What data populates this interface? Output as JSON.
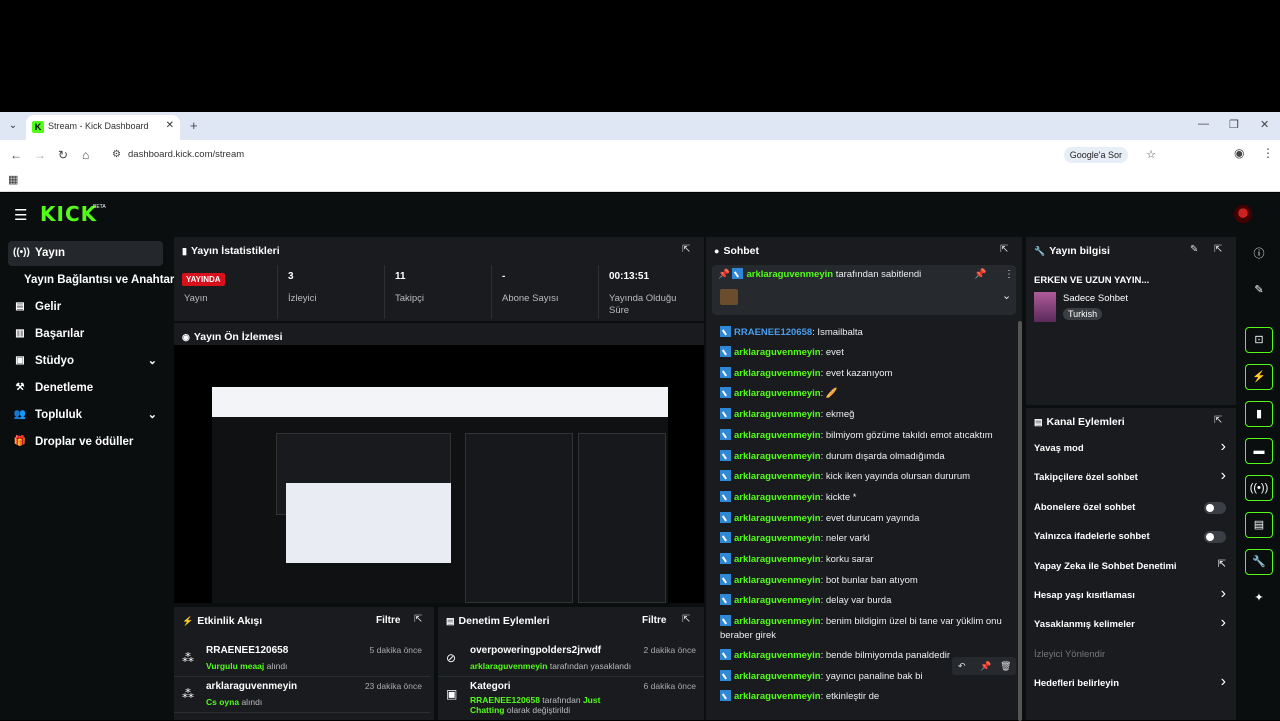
{
  "browser": {
    "tab_title": "Stream - Kick Dashboard",
    "url": "dashboard.kick.com/stream",
    "google_lens": "Google'a Sor"
  },
  "app": {
    "logo": "KICK",
    "logo_badge": "BETA"
  },
  "sidebar": {
    "items": [
      {
        "label": "Yayın",
        "icon": "broadcast-icon"
      },
      {
        "label": "Yayın Bağlantısı ve Anahtarı"
      },
      {
        "label": "Gelir",
        "icon": "revenue-icon"
      },
      {
        "label": "Başarılar",
        "icon": "achievements-icon"
      },
      {
        "label": "Stüdyo",
        "icon": "studio-icon"
      },
      {
        "label": "Denetleme",
        "icon": "moderation-icon"
      },
      {
        "label": "Topluluk",
        "icon": "community-icon"
      },
      {
        "label": "Droplar ve ödüller",
        "icon": "drops-icon"
      }
    ]
  },
  "stats": {
    "title": "Yayın İstatistikleri",
    "live_badge": "YAYINDA",
    "items": [
      {
        "value": "",
        "label": "Yayın"
      },
      {
        "value": "3",
        "label": "İzleyici"
      },
      {
        "value": "11",
        "label": "Takipçi"
      },
      {
        "value": "-",
        "label": "Abone Sayısı"
      },
      {
        "value": "00:13:51",
        "label": "Yayında Olduğu Süre"
      }
    ]
  },
  "preview": {
    "title": "Yayın Ön İzlemesi"
  },
  "activity": {
    "title": "Etkinlik Akışı",
    "filter": "Filtre",
    "items": [
      {
        "name": "RRAENEE120658",
        "highlight": "Vurgulu meaaj",
        "rest": " alındı",
        "time": "5 dakika önce"
      },
      {
        "name": "arklaraguvenmeyin",
        "highlight": "Cs oyna",
        "rest": " alındı",
        "time": "23 dakika önce"
      }
    ]
  },
  "mod_actions": {
    "title": "Denetim Eylemleri",
    "filter": "Filtre",
    "items": [
      {
        "name": "overpoweringpolders2jrwdf",
        "highlight": "arklaraguvenmeyin",
        "rest": " tarafından yasaklandı",
        "time": "2 dakika önce"
      },
      {
        "name": "Kategori",
        "highlight": "RRAENEE120658",
        "mid": " tarafından ",
        "highlight2": "Just Chatting",
        "rest": " olarak değiştirildi",
        "time": "6 dakika önce"
      }
    ]
  },
  "chat": {
    "title": "Sohbet",
    "pinned": {
      "user": "arklaraguvenmeyin",
      "text": " tarafından sabitlendi"
    },
    "messages": [
      {
        "user": "RRAENEE120658",
        "text": ": Ismailbalta",
        "blue": true
      },
      {
        "user": "arklaraguvenmeyin",
        "text": ": evet"
      },
      {
        "user": "arklaraguvenmeyin",
        "text": ": evet kazanıyom"
      },
      {
        "user": "arklaraguvenmeyin",
        "text": ": 🥖"
      },
      {
        "user": "arklaraguvenmeyin",
        "text": ": ekmeğ"
      },
      {
        "user": "arklaraguvenmeyin",
        "text": ": bilmiyom gözüme takıldı emot atıcaktım"
      },
      {
        "user": "arklaraguvenmeyin",
        "text": ": durum dışarda olmadığımda"
      },
      {
        "user": "arklaraguvenmeyin",
        "text": ": kick iken yayında olursan dururum"
      },
      {
        "user": "arklaraguvenmeyin",
        "text": ": kickte *"
      },
      {
        "user": "arklaraguvenmeyin",
        "text": ": evet durucam yayında"
      },
      {
        "user": "arklaraguvenmeyin",
        "text": ": neler varkl"
      },
      {
        "user": "arklaraguvenmeyin",
        "text": ": korku sarar"
      },
      {
        "user": "arklaraguvenmeyin",
        "text": ": bot bunlar ban atıyom"
      },
      {
        "user": "arklaraguvenmeyin",
        "text": ": delay var burda"
      },
      {
        "user": "arklaraguvenmeyin",
        "text": ": benim bildigim üzel bi tane var yüklim onu"
      },
      {
        "user": "",
        "text": "beraber girek"
      },
      {
        "user": "arklaraguvenmeyin",
        "text": ": bende bilmiyomda panaldedir"
      },
      {
        "user": "arklaraguvenmeyin",
        "text": ": yayıncı panaline bak bi"
      },
      {
        "user": "arklaraguvenmeyin",
        "text": ": etkinleştir de"
      }
    ]
  },
  "stream_info": {
    "title": "Yayın bilgisi",
    "stream_title": "ERKEN VE UZUN YAYIN...",
    "category": "Sadece Sohbet",
    "language": "Turkish"
  },
  "channel_actions": {
    "title": "Kanal Eylemleri",
    "items": [
      {
        "label": "Yavaş mod",
        "ctrl": "chevron"
      },
      {
        "label": "Takipçilere özel sohbet",
        "ctrl": "chevron"
      },
      {
        "label": "Abonelere özel sohbet",
        "ctrl": "toggle"
      },
      {
        "label": "Yalnızca ifadelerle sohbet",
        "ctrl": "toggle"
      },
      {
        "label": "Yapay Zeka ile Sohbet Denetimi",
        "ctrl": "external"
      },
      {
        "label": "Hesap yaşı kısıtlaması",
        "ctrl": "chevron"
      },
      {
        "label": "Yasaklanmış kelimeler",
        "ctrl": "chevron"
      },
      {
        "label": "İzleyici Yönlendir",
        "ctrl": "none",
        "muted": true
      },
      {
        "label": "Hedefleri belirleyin",
        "ctrl": "chevron"
      }
    ]
  }
}
